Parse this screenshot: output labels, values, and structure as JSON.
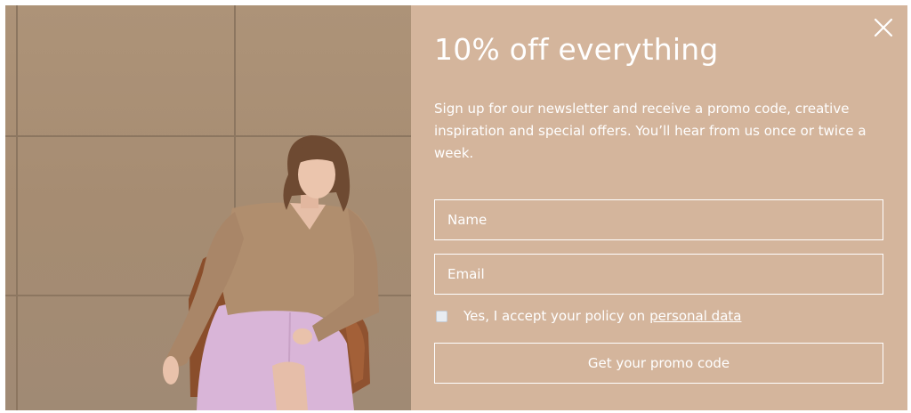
{
  "popup": {
    "title": "10% off everything",
    "description": "Sign up for our newsletter and receive a promo code, creative inspiration and special offers. You’ll hear from us once or twice a week.",
    "name_placeholder": "Name",
    "email_placeholder": "Email",
    "consent_text": "Yes, I accept your policy on",
    "consent_link": "personal data",
    "submit_label": "Get your promo code",
    "consent_checked": false
  },
  "icons": {
    "close": "close-icon",
    "checkbox": "checkbox-icon"
  },
  "colors": {
    "panel_background": "#d4b59c",
    "text": "#ffffff",
    "wall": "#a68c72",
    "sweater": "#b08e6e",
    "skirt": "#d9b5d8",
    "chair": "#8a4e2b"
  }
}
